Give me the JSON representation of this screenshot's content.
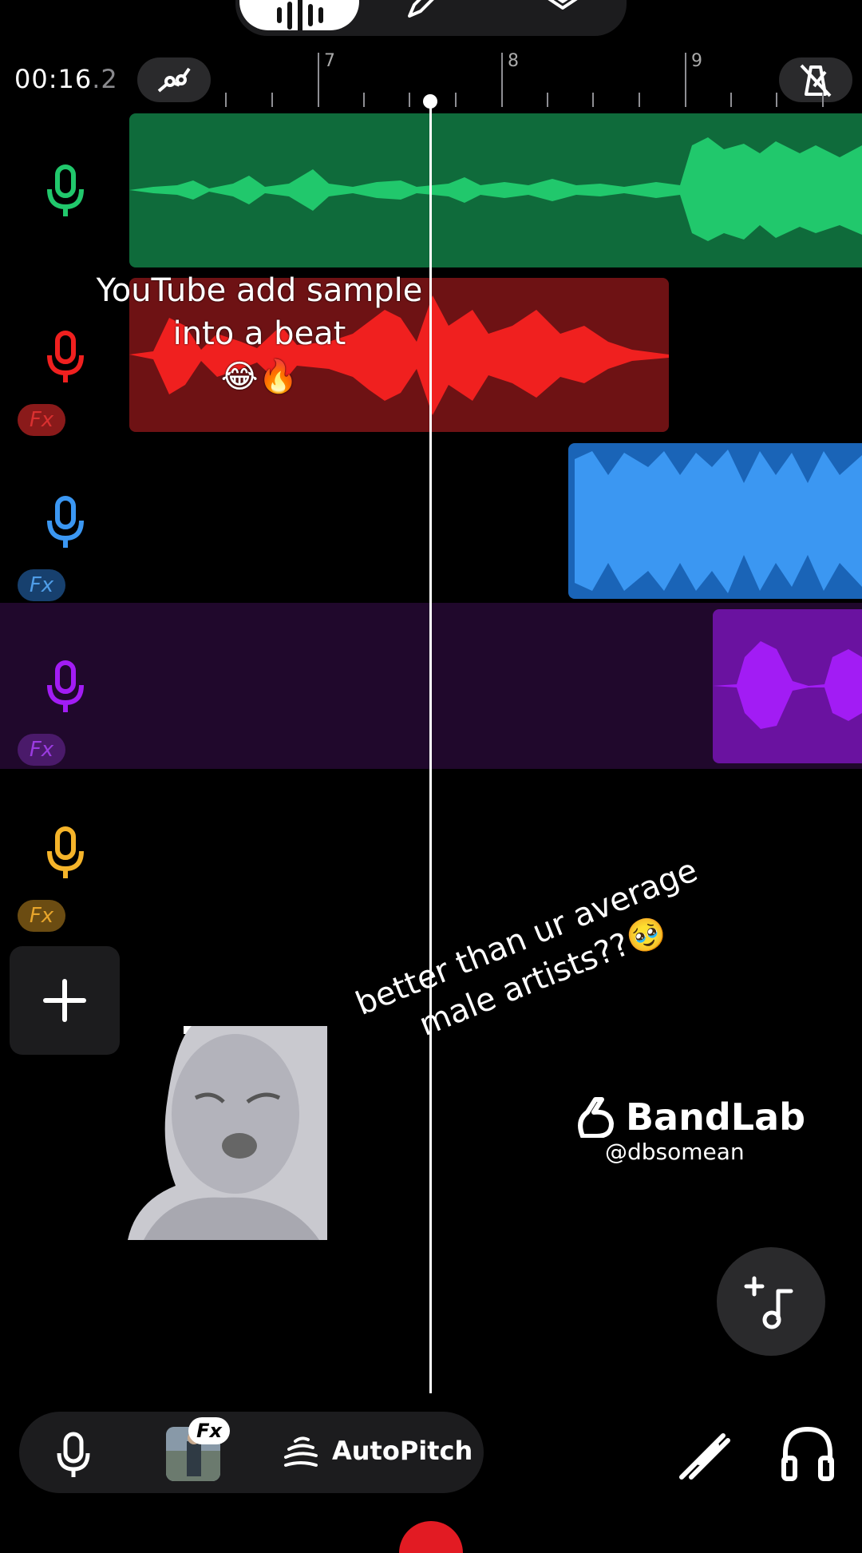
{
  "header": {
    "time_main": "00:16",
    "time_fraction": ".2",
    "ruler_labels": [
      "7",
      "8",
      "9"
    ]
  },
  "tracks": [
    {
      "name": "track-1",
      "color": "#0f6b3b",
      "wave": "#21c86c",
      "icon": "mic-icon",
      "fx": false
    },
    {
      "name": "track-2",
      "color": "#6e1214",
      "wave": "#f0201f",
      "icon": "mic-icon",
      "fx": true,
      "fx_label": "Fx",
      "fx_color": "#8a1a1a",
      "fx_text": "#d93030"
    },
    {
      "name": "track-3",
      "color": "#1a64b7",
      "wave": "#3b97f2",
      "icon": "mic-icon",
      "fx": true,
      "fx_label": "Fx",
      "fx_color": "#17406e",
      "fx_text": "#4f9de8"
    },
    {
      "name": "track-4",
      "color": "#3e0f58",
      "wave": "#a21cf4",
      "icon": "mic-icon",
      "fx": true,
      "fx_label": "Fx",
      "fx_color": "#4a1a6a",
      "fx_text": "#9a3be0"
    },
    {
      "name": "track-5",
      "color": "#000000",
      "wave": "#f5b42a",
      "icon": "mic-icon",
      "fx": true,
      "fx_label": "Fx",
      "fx_color": "#6b4c12",
      "fx_text": "#e7a52b"
    }
  ],
  "captions": {
    "sample_line1": "YouTube add sample",
    "sample_line2": "into a beat",
    "sample_emoji": "😂🔥",
    "artists_line1": "better than ur average",
    "artists_line2": "male artists??🥹"
  },
  "watermark": {
    "brand": "BandLab",
    "handle": "@dbsomean"
  },
  "bottom_bar": {
    "fx_chip": "Fx",
    "autopitch_label": "AutoPitch"
  },
  "colors": {
    "accent_record": "#e21b23",
    "panel": "#1c1c1e"
  }
}
